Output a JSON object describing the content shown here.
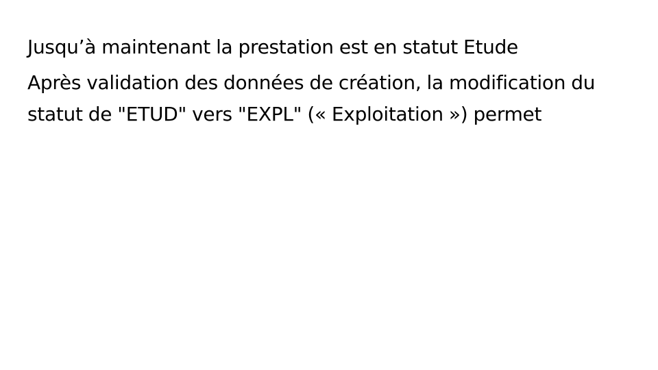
{
  "slide": {
    "paragraphs": [
      "Jusqu’à maintenant la prestation est en statut Etude",
      "Après validation des données de création, la modification du statut de \"ETUD\" vers \"EXPL\" (« Exploitation ») permet"
    ]
  }
}
